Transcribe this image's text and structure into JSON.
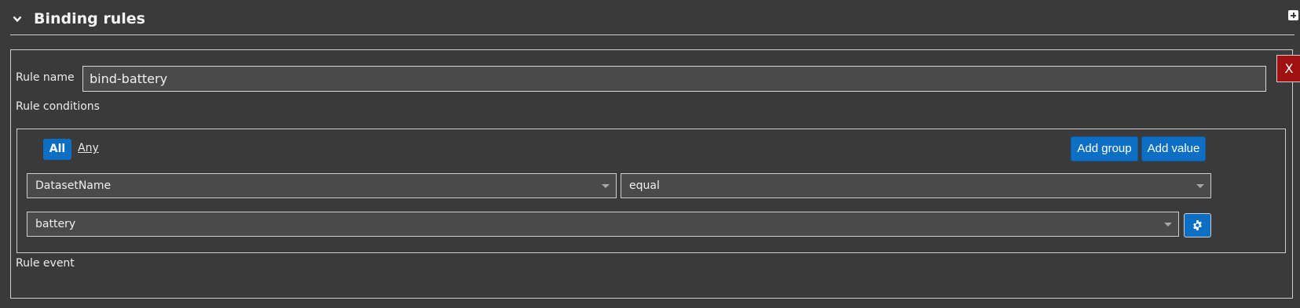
{
  "section": {
    "title": "Binding rules",
    "collapse_icon": "chevron-down-icon",
    "add_icon": "plus-square-icon"
  },
  "rule": {
    "name_label": "Rule name",
    "name_value": "bind-battery",
    "delete_label": "X",
    "conditions_label": "Rule conditions",
    "event_label": "Rule event"
  },
  "conditions": {
    "combinator_all": "All",
    "combinator_any": "Any",
    "active_combinator": "All",
    "add_group_label": "Add group",
    "add_value_label": "Add value",
    "field_select": "DatasetName",
    "operator_select": "equal",
    "value_select": "battery",
    "settings_icon": "gear-icon"
  },
  "colors": {
    "background": "#3a3a3a",
    "accent": "#0d6fc4",
    "danger": "#a01010",
    "border": "#cfcfcf",
    "input_bg": "#4a4a4a"
  }
}
